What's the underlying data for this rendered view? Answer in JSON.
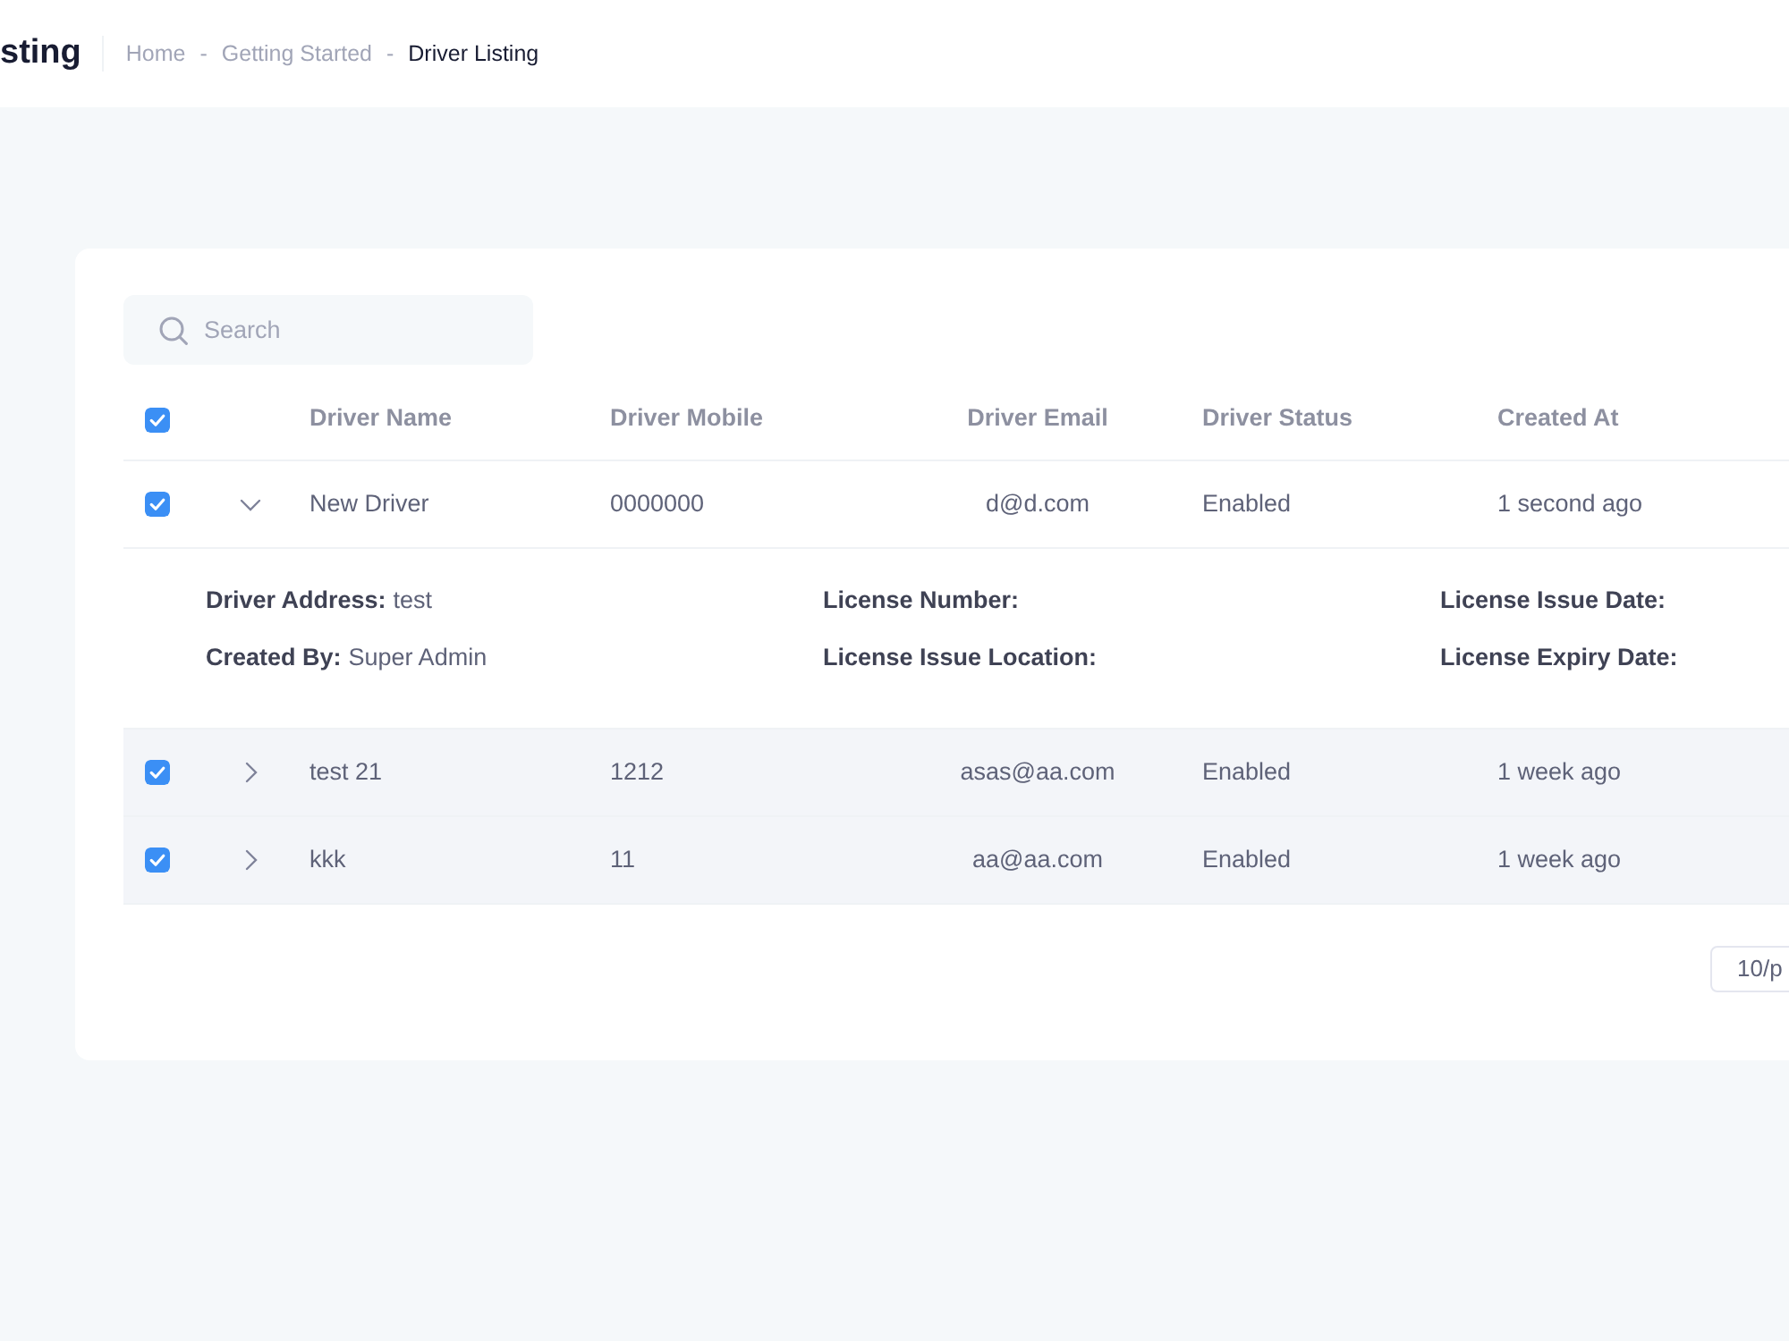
{
  "header": {
    "page_title": "sting",
    "breadcrumb": [
      {
        "label": "Home",
        "current": false
      },
      {
        "separator": "-",
        "label": "Getting Started",
        "current": false
      },
      {
        "separator": "-",
        "label": "Driver Listing",
        "current": true
      }
    ]
  },
  "search": {
    "placeholder": "Search"
  },
  "table": {
    "select_all": {
      "checked": true
    },
    "columns": [
      "Driver Name",
      "Driver Mobile",
      "Driver Email",
      "Driver Status",
      "Created At"
    ],
    "rows": [
      {
        "checked": true,
        "expanded": true,
        "highlighted": false,
        "cells": [
          "New Driver",
          "0000000",
          "d@d.com",
          "Enabled",
          "1 second ago"
        ],
        "details": [
          {
            "label": "Driver Address:",
            "value": "test"
          },
          {
            "label": "License Number:"
          },
          {
            "label": "License Issue Date:"
          },
          {
            "label": "Created By:",
            "value": "Super Admin"
          },
          {
            "label": "License Issue Location:"
          },
          {
            "label": "License Expiry Date:"
          }
        ]
      },
      {
        "checked": true,
        "expanded": false,
        "highlighted": true,
        "cells": [
          "test 21",
          "1212",
          "asas@aa.com",
          "Enabled",
          "1 week ago"
        ]
      },
      {
        "checked": true,
        "expanded": false,
        "highlighted": true,
        "cells": [
          "kkk",
          "11",
          "aa@aa.com",
          "Enabled",
          "1 week ago"
        ]
      }
    ]
  },
  "pagination": {
    "page_size": "10/p"
  }
}
